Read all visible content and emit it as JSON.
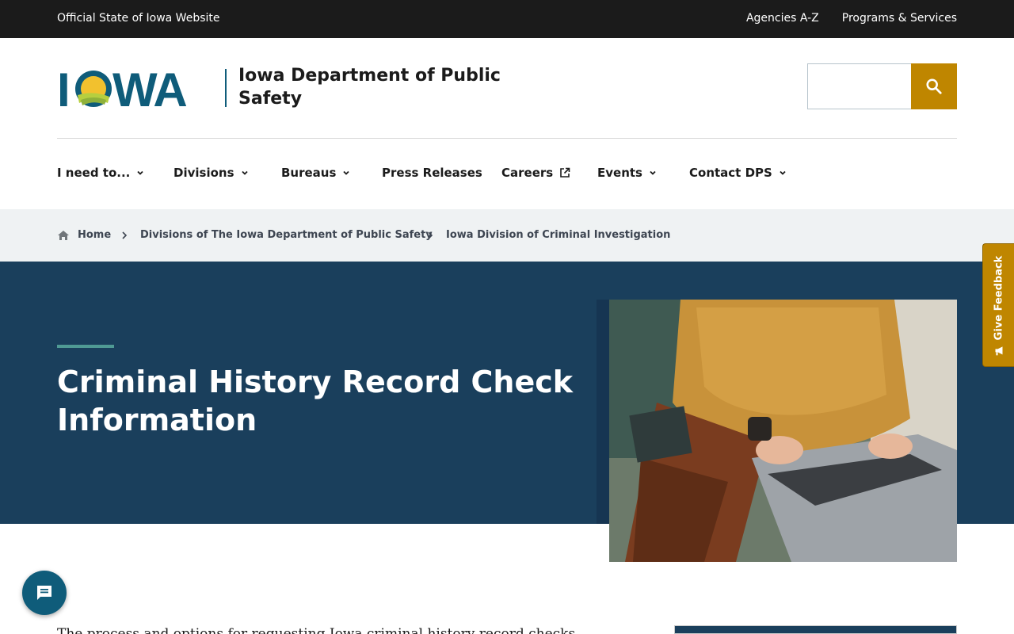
{
  "topbar": {
    "official_label": "Official State of Iowa Website",
    "links": [
      "Agencies A-Z",
      "Programs & Services"
    ]
  },
  "header": {
    "logo_text": "IOWA",
    "department_name": "Iowa Department of Public Safety",
    "search": {
      "value": "",
      "placeholder": ""
    }
  },
  "nav": {
    "items": [
      {
        "label": "I need to...",
        "icon": "chevron-down-icon"
      },
      {
        "label": "Divisions",
        "icon": "chevron-down-icon"
      },
      {
        "label": "Bureaus",
        "icon": "chevron-down-icon"
      },
      {
        "label": "Press Releases",
        "icon": ""
      },
      {
        "label": "Careers",
        "icon": "external-link-icon"
      },
      {
        "label": "Events",
        "icon": "chevron-down-icon"
      },
      {
        "label": "Contact DPS",
        "icon": "chevron-down-icon"
      }
    ]
  },
  "breadcrumbs": [
    {
      "label": "Home",
      "icon": "home-icon"
    },
    {
      "label": "Divisions of The Iowa Department of Public Safety"
    },
    {
      "label": "Iowa Division of Criminal Investigation"
    }
  ],
  "hero": {
    "title": "Criminal History Record Check Information"
  },
  "feedback": {
    "label": "Give Feedback",
    "icon": "megaphone-icon"
  },
  "chat": {
    "icon": "chat-bubble-icon"
  },
  "body": {
    "intro_fragment": "The process and options for requesting Iowa criminal history record checks"
  },
  "colors": {
    "topbar": "#1b1b1b",
    "brand_teal": "#0f5c7a",
    "accent_gold": "#bf8600",
    "hero_navy": "#1a3f5c",
    "breadcrumb_bg": "#eff2f3",
    "hero_accent_line": "#4f9a94"
  }
}
